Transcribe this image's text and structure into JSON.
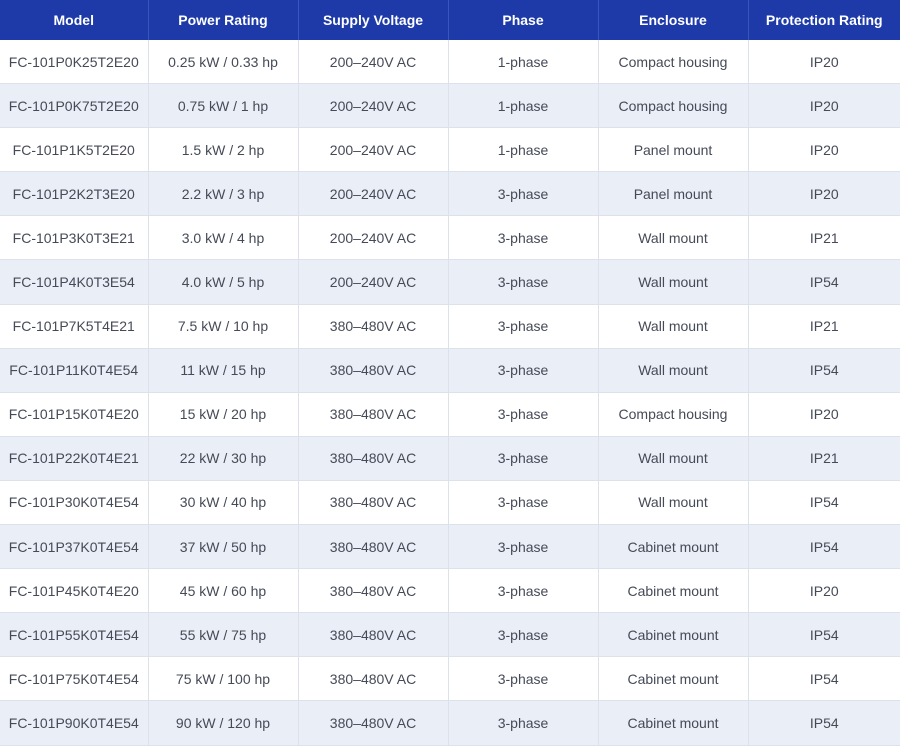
{
  "table": {
    "headers": [
      "Model",
      "Power Rating",
      "Supply Voltage",
      "Phase",
      "Enclosure",
      "Protection Rating"
    ],
    "rows": [
      [
        "FC-101P0K25T2E20",
        "0.25 kW / 0.33 hp",
        "200–240V AC",
        "1-phase",
        "Compact housing",
        "IP20"
      ],
      [
        "FC-101P0K75T2E20",
        "0.75 kW / 1 hp",
        "200–240V AC",
        "1-phase",
        "Compact housing",
        "IP20"
      ],
      [
        "FC-101P1K5T2E20",
        "1.5 kW / 2 hp",
        "200–240V AC",
        "1-phase",
        "Panel mount",
        "IP20"
      ],
      [
        "FC-101P2K2T3E20",
        "2.2 kW / 3 hp",
        "200–240V AC",
        "3-phase",
        "Panel mount",
        "IP20"
      ],
      [
        "FC-101P3K0T3E21",
        "3.0 kW / 4 hp",
        "200–240V AC",
        "3-phase",
        "Wall mount",
        "IP21"
      ],
      [
        "FC-101P4K0T3E54",
        "4.0 kW / 5 hp",
        "200–240V AC",
        "3-phase",
        "Wall mount",
        "IP54"
      ],
      [
        "FC-101P7K5T4E21",
        "7.5 kW / 10 hp",
        "380–480V AC",
        "3-phase",
        "Wall mount",
        "IP21"
      ],
      [
        "FC-101P11K0T4E54",
        "11 kW / 15 hp",
        "380–480V AC",
        "3-phase",
        "Wall mount",
        "IP54"
      ],
      [
        "FC-101P15K0T4E20",
        "15 kW / 20 hp",
        "380–480V AC",
        "3-phase",
        "Compact housing",
        "IP20"
      ],
      [
        "FC-101P22K0T4E21",
        "22 kW / 30 hp",
        "380–480V AC",
        "3-phase",
        "Wall mount",
        "IP21"
      ],
      [
        "FC-101P30K0T4E54",
        "30 kW / 40 hp",
        "380–480V AC",
        "3-phase",
        "Wall mount",
        "IP54"
      ],
      [
        "FC-101P37K0T4E54",
        "37 kW / 50 hp",
        "380–480V AC",
        "3-phase",
        "Cabinet mount",
        "IP54"
      ],
      [
        "FC-101P45K0T4E20",
        "45 kW / 60 hp",
        "380–480V AC",
        "3-phase",
        "Cabinet mount",
        "IP20"
      ],
      [
        "FC-101P55K0T4E54",
        "55 kW / 75 hp",
        "380–480V AC",
        "3-phase",
        "Cabinet mount",
        "IP54"
      ],
      [
        "FC-101P75K0T4E54",
        "75 kW / 100 hp",
        "380–480V AC",
        "3-phase",
        "Cabinet mount",
        "IP54"
      ],
      [
        "FC-101P90K0T4E54",
        "90 kW / 120 hp",
        "380–480V AC",
        "3-phase",
        "Cabinet mount",
        "IP54"
      ]
    ]
  },
  "colors": {
    "header_bg": "#1d3aa8",
    "header_text": "#ffffff",
    "row_alt_bg": "#eaeef6",
    "cell_text": "#454a57"
  }
}
